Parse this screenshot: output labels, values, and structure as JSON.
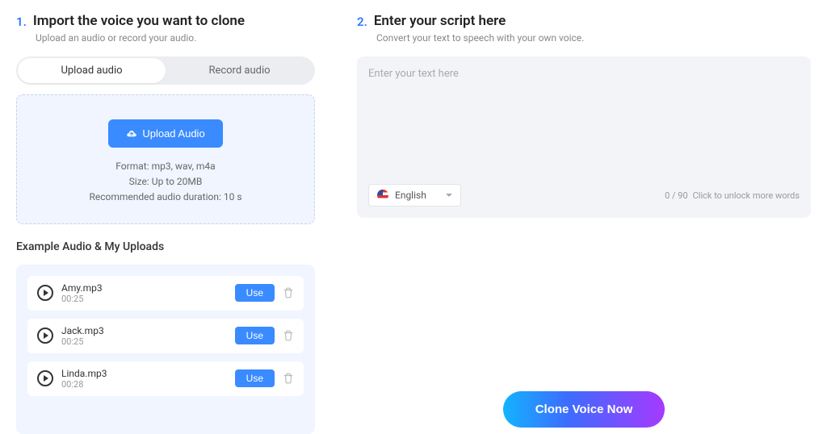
{
  "step1": {
    "number": "1.",
    "title": "Import the voice you want to clone",
    "subtitle": "Upload an audio or record your audio."
  },
  "tabs": {
    "upload": "Upload audio",
    "record": "Record audio"
  },
  "upload": {
    "button": "Upload Audio",
    "format": "Format: mp3, wav, m4a",
    "size": "Size: Up to 20MB",
    "duration": "Recommended audio duration: 10 s"
  },
  "examples": {
    "title": "Example Audio & My Uploads",
    "use_label": "Use",
    "items": [
      {
        "name": "Amy.mp3",
        "duration": "00:25"
      },
      {
        "name": "Jack.mp3",
        "duration": "00:25"
      },
      {
        "name": "Linda.mp3",
        "duration": "00:28"
      }
    ]
  },
  "step2": {
    "number": "2.",
    "title": "Enter your script here",
    "subtitle": "Convert your text to speech with your own voice."
  },
  "editor": {
    "placeholder": "Enter your text here",
    "language": "English",
    "counter": "0 / 90",
    "unlock": "Click to unlock more words"
  },
  "cta": "Clone Voice Now"
}
